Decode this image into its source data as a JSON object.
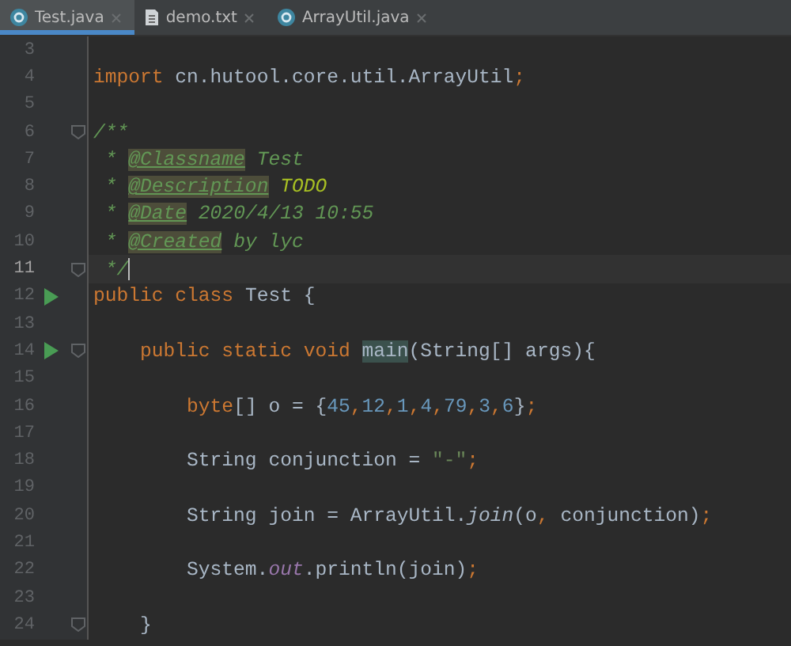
{
  "tabs": [
    {
      "label": "Test.java",
      "kind": "java",
      "selected": true
    },
    {
      "label": "demo.txt",
      "kind": "text",
      "selected": false
    },
    {
      "label": "ArrayUtil.java",
      "kind": "class",
      "selected": false
    }
  ],
  "lines": [
    {
      "number": "3",
      "current": false,
      "run": false,
      "fold": false
    },
    {
      "number": "4",
      "current": false,
      "run": false,
      "fold": false,
      "tokens": [
        {
          "text": "import",
          "kind": "keyword"
        },
        {
          "text": " cn.hutool.core.util.ArrayUtil",
          "kind": "plain"
        },
        {
          "text": ";",
          "kind": "keyword"
        }
      ]
    },
    {
      "number": "5",
      "current": false,
      "run": false,
      "fold": false
    },
    {
      "number": "6",
      "current": false,
      "run": false,
      "fold": true,
      "tokens": [
        {
          "text": "/**",
          "kind": "doc"
        }
      ]
    },
    {
      "number": "7",
      "current": false,
      "run": false,
      "fold": false,
      "tokens": [
        {
          "text": " * ",
          "kind": "doc"
        },
        {
          "text": "@Classname",
          "kind": "doctag"
        },
        {
          "text": " Test",
          "kind": "doc"
        }
      ]
    },
    {
      "number": "8",
      "current": false,
      "run": false,
      "fold": false,
      "tokens": [
        {
          "text": " * ",
          "kind": "doc"
        },
        {
          "text": "@Description",
          "kind": "doctag"
        },
        {
          "text": " TODO",
          "kind": "todo"
        }
      ]
    },
    {
      "number": "9",
      "current": false,
      "run": false,
      "fold": false,
      "tokens": [
        {
          "text": " * ",
          "kind": "doc"
        },
        {
          "text": "@Date",
          "kind": "doctag"
        },
        {
          "text": " 2020/4/13 10:55",
          "kind": "doc"
        }
      ]
    },
    {
      "number": "10",
      "current": false,
      "run": false,
      "fold": false,
      "tokens": [
        {
          "text": " * ",
          "kind": "doc"
        },
        {
          "text": "@Created",
          "kind": "doctag"
        },
        {
          "text": " by lyc",
          "kind": "doc"
        }
      ]
    },
    {
      "number": "11",
      "current": true,
      "run": false,
      "fold": true,
      "tokens": [
        {
          "text": " */",
          "kind": "doc"
        }
      ]
    },
    {
      "number": "12",
      "current": false,
      "run": true,
      "fold": false,
      "tokens": [
        {
          "text": "public class",
          "kind": "keyword"
        },
        {
          "text": " Test {",
          "kind": "plain"
        }
      ]
    },
    {
      "number": "13",
      "current": false,
      "run": false,
      "fold": false
    },
    {
      "number": "14",
      "current": false,
      "run": true,
      "fold": true,
      "tokens": [
        {
          "text": "    public static void ",
          "kind": "keyword"
        },
        {
          "text": "main",
          "kind": "match"
        },
        {
          "text": "(String[] args){",
          "kind": "plain"
        }
      ]
    },
    {
      "number": "15",
      "current": false,
      "run": false,
      "fold": false
    },
    {
      "number": "16",
      "current": false,
      "run": false,
      "fold": false,
      "tokens": [
        {
          "text": "        byte",
          "kind": "keyword"
        },
        {
          "text": "[] o = {",
          "kind": "plain"
        },
        {
          "text": "45",
          "kind": "number"
        },
        {
          "text": ",",
          "kind": "keyword"
        },
        {
          "text": "12",
          "kind": "number"
        },
        {
          "text": ",",
          "kind": "keyword"
        },
        {
          "text": "1",
          "kind": "number"
        },
        {
          "text": ",",
          "kind": "keyword"
        },
        {
          "text": "4",
          "kind": "number"
        },
        {
          "text": ",",
          "kind": "keyword"
        },
        {
          "text": "79",
          "kind": "number"
        },
        {
          "text": ",",
          "kind": "keyword"
        },
        {
          "text": "3",
          "kind": "number"
        },
        {
          "text": ",",
          "kind": "keyword"
        },
        {
          "text": "6",
          "kind": "number"
        },
        {
          "text": "}",
          "kind": "plain"
        },
        {
          "text": ";",
          "kind": "keyword"
        }
      ]
    },
    {
      "number": "17",
      "current": false,
      "run": false,
      "fold": false
    },
    {
      "number": "18",
      "current": false,
      "run": false,
      "fold": false,
      "tokens": [
        {
          "text": "        String conjunction = ",
          "kind": "plain"
        },
        {
          "text": "\"-\"",
          "kind": "string"
        },
        {
          "text": ";",
          "kind": "keyword"
        }
      ]
    },
    {
      "number": "19",
      "current": false,
      "run": false,
      "fold": false
    },
    {
      "number": "20",
      "current": false,
      "run": false,
      "fold": false,
      "tokens": [
        {
          "text": "        String join = ArrayUtil.",
          "kind": "plain"
        },
        {
          "text": "join",
          "kind": "static"
        },
        {
          "text": "(o",
          "kind": "plain"
        },
        {
          "text": ",",
          "kind": "keyword"
        },
        {
          "text": " conjunction)",
          "kind": "plain"
        },
        {
          "text": ";",
          "kind": "keyword"
        }
      ]
    },
    {
      "number": "21",
      "current": false,
      "run": false,
      "fold": false
    },
    {
      "number": "22",
      "current": false,
      "run": false,
      "fold": false,
      "tokens": [
        {
          "text": "        System.",
          "kind": "plain"
        },
        {
          "text": "out",
          "kind": "field"
        },
        {
          "text": ".println(join)",
          "kind": "plain"
        },
        {
          "text": ";",
          "kind": "keyword"
        }
      ]
    },
    {
      "number": "23",
      "current": false,
      "run": false,
      "fold": false
    },
    {
      "number": "24",
      "current": false,
      "run": false,
      "fold": true,
      "tokens": [
        {
          "text": "    }",
          "kind": "plain"
        }
      ]
    }
  ]
}
